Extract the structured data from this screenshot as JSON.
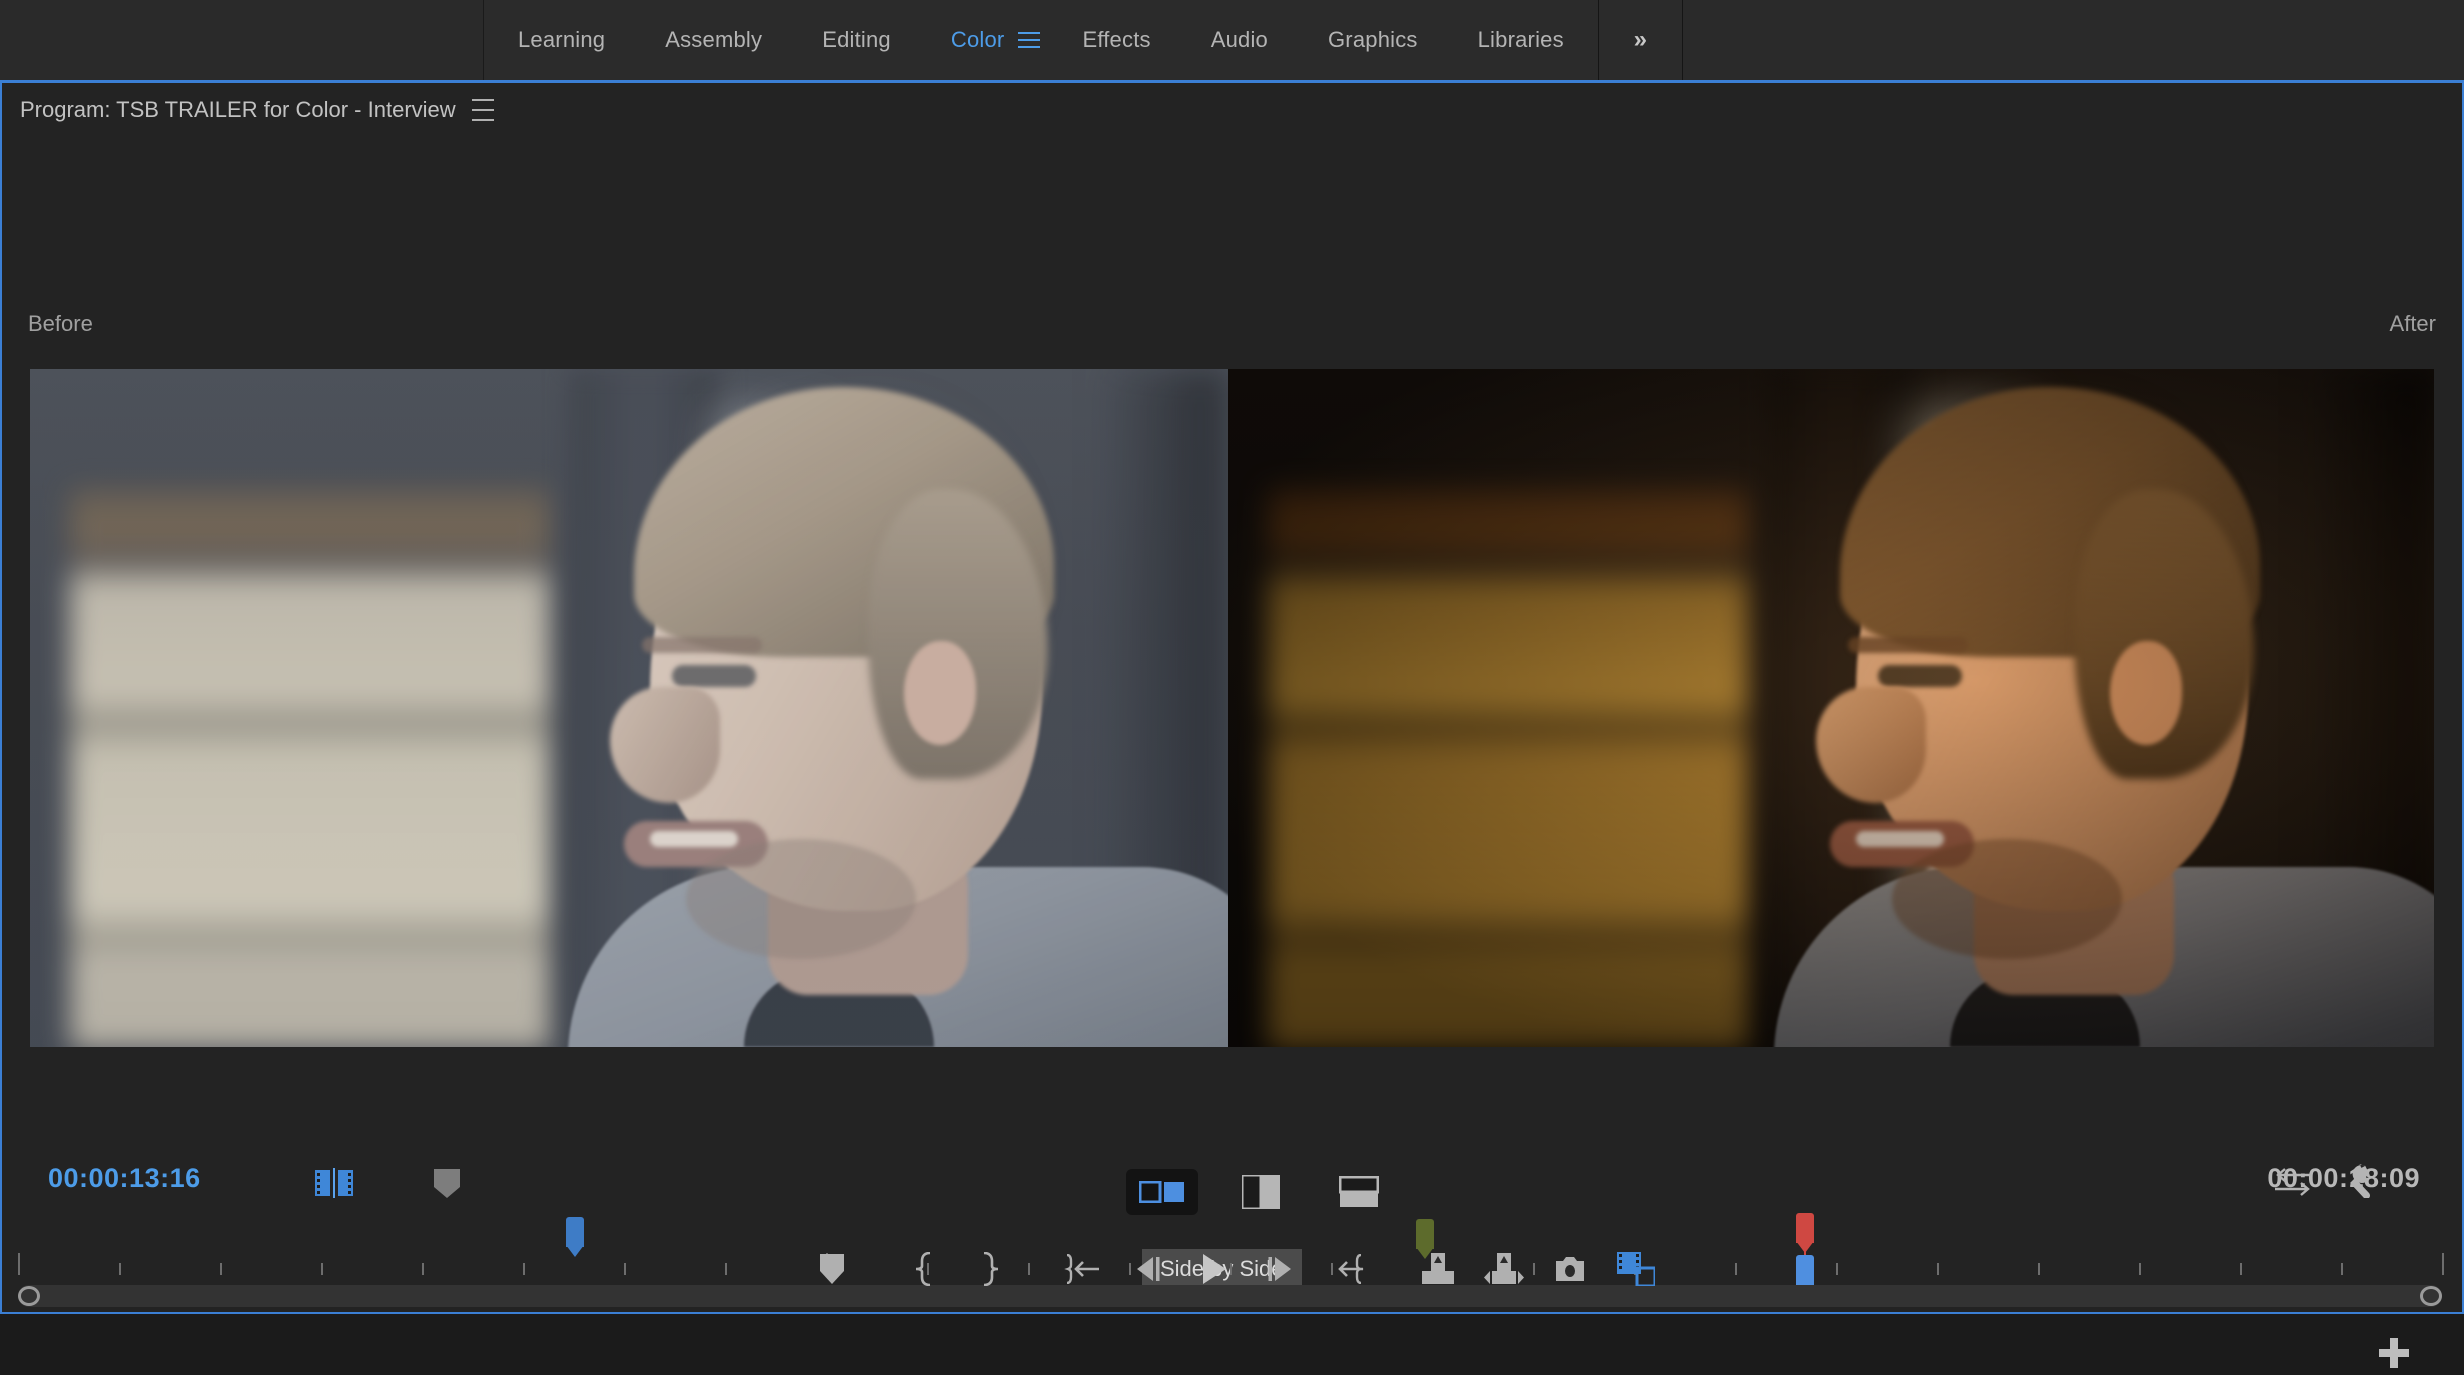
{
  "app": {
    "accent_blue": "#4d9ce8",
    "panel_border_blue": "#3b7fd4",
    "background": "#232323"
  },
  "workspace_bar": {
    "tabs": [
      {
        "label": "Learning",
        "active": false
      },
      {
        "label": "Assembly",
        "active": false
      },
      {
        "label": "Editing",
        "active": false
      },
      {
        "label": "Color",
        "active": true
      },
      {
        "label": "Effects",
        "active": false
      },
      {
        "label": "Audio",
        "active": false
      },
      {
        "label": "Graphics",
        "active": false
      },
      {
        "label": "Libraries",
        "active": false
      }
    ],
    "active_menu_icon": "hamburger-menu-icon",
    "overflow_label": "»"
  },
  "program_panel": {
    "title": "Program: TSB TRAILER for Color - Interview",
    "panel_menu_icon": "panel-menu-icon",
    "comparison": {
      "before_label": "Before",
      "after_label": "After",
      "active_mode": "Side by Side",
      "tooltip": "Side by Side",
      "modes": [
        {
          "name": "side-by-side",
          "icon": "side-by-side-icon",
          "selected": true
        },
        {
          "name": "vertical-split",
          "icon": "vertical-split-icon",
          "selected": false
        },
        {
          "name": "horizontal-split",
          "icon": "horizontal-split-icon",
          "selected": false
        }
      ]
    },
    "transport": {
      "current_timecode": "00:00:13:16",
      "duration_timecode": "00:00:18:09",
      "left_icons": [
        {
          "name": "comparison-view-icon",
          "label": "Comparison View"
        },
        {
          "name": "marker-tag-icon",
          "label": "Marker"
        }
      ],
      "right_icons": [
        {
          "name": "swap-arrows-icon",
          "label": "Export Frame Swap"
        },
        {
          "name": "wrench-icon",
          "label": "Settings"
        }
      ],
      "buttons": [
        {
          "name": "add-marker-button",
          "icon": "marker-icon"
        },
        {
          "name": "mark-in-button",
          "icon": "mark-in-icon"
        },
        {
          "name": "mark-out-button",
          "icon": "mark-out-icon"
        },
        {
          "name": "go-to-in-button",
          "icon": "go-to-in-icon"
        },
        {
          "name": "step-back-button",
          "icon": "step-back-icon"
        },
        {
          "name": "play-stop-button",
          "icon": "play-icon"
        },
        {
          "name": "step-forward-button",
          "icon": "step-forward-icon"
        },
        {
          "name": "go-to-out-button",
          "icon": "go-to-out-icon"
        },
        {
          "name": "lift-button",
          "icon": "lift-icon"
        },
        {
          "name": "extract-button",
          "icon": "extract-icon"
        },
        {
          "name": "export-frame-button",
          "icon": "camera-icon"
        },
        {
          "name": "comparison-view-button",
          "icon": "comparison-view-icon"
        }
      ],
      "add-button-label": "+"
    },
    "timeline": {
      "markers": [
        {
          "name": "in-point-marker",
          "color": "#3e7cc6",
          "position_pct": 23.3
        },
        {
          "name": "segment-marker",
          "color": "#5d6b2c",
          "position_pct": 58.3
        },
        {
          "name": "out-point-marker",
          "color": "#cf4842",
          "position_pct": 73.9
        },
        {
          "name": "playhead",
          "color": "#4f8fe0",
          "position_pct": 73.9
        }
      ],
      "tick_count": 24,
      "scrollbar": {
        "left_handle": "zoom-handle-left",
        "right_handle": "zoom-handle-right"
      }
    }
  }
}
